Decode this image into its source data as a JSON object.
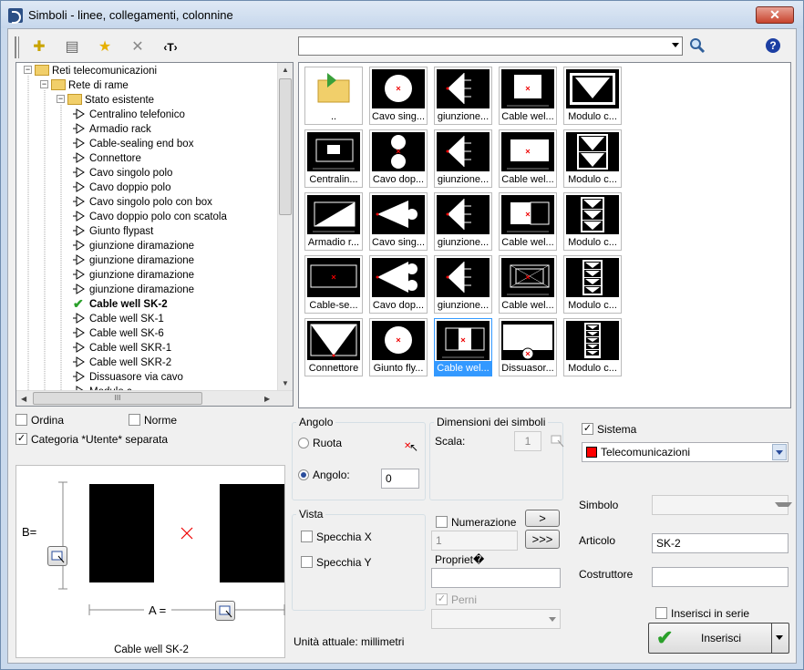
{
  "window": {
    "title": "Simboli - linee, collegamenti, colonnine",
    "close_glyph": "✕"
  },
  "toolbar": {
    "buttons": [
      {
        "name": "add-icon",
        "glyph": "✚"
      },
      {
        "name": "properties-icon",
        "glyph": "▤"
      },
      {
        "name": "favorite-star-icon",
        "glyph": "★"
      },
      {
        "name": "delete-icon",
        "glyph": "✕"
      },
      {
        "name": "text-tag-icon",
        "glyph": "‹T›"
      }
    ],
    "search_value": "",
    "search_icon": "magnifier-icon",
    "help_glyph": "?"
  },
  "tree": {
    "nodes": [
      {
        "label": "Reti telecomunicazioni",
        "type": "folder",
        "level": 0
      },
      {
        "label": "Rete di rame",
        "type": "folder",
        "level": 1
      },
      {
        "label": "Stato esistente",
        "type": "folder",
        "level": 2
      },
      {
        "label": "Centralino telefonico",
        "type": "symbol",
        "level": 3
      },
      {
        "label": "Armadio rack",
        "type": "symbol",
        "level": 3
      },
      {
        "label": "Cable-sealing end box",
        "type": "symbol",
        "level": 3
      },
      {
        "label": "Connettore",
        "type": "symbol",
        "level": 3
      },
      {
        "label": "Cavo singolo polo",
        "type": "symbol",
        "level": 3
      },
      {
        "label": "Cavo doppio polo",
        "type": "symbol",
        "level": 3
      },
      {
        "label": "Cavo singolo polo con box",
        "type": "symbol",
        "level": 3
      },
      {
        "label": "Cavo doppio polo con scatola",
        "type": "symbol",
        "level": 3
      },
      {
        "label": "Giunto flypast",
        "type": "symbol",
        "level": 3
      },
      {
        "label": "giunzione diramazione",
        "type": "symbol",
        "level": 3
      },
      {
        "label": "giunzione diramazione",
        "type": "symbol",
        "level": 3
      },
      {
        "label": "giunzione diramazione",
        "type": "symbol",
        "level": 3
      },
      {
        "label": "giunzione diramazione",
        "type": "symbol",
        "level": 3
      },
      {
        "label": "Cable well SK-2",
        "type": "selected",
        "level": 3
      },
      {
        "label": "Cable well SK-1",
        "type": "symbol",
        "level": 3
      },
      {
        "label": "Cable well SK-6",
        "type": "symbol",
        "level": 3
      },
      {
        "label": "Cable well SKR-1",
        "type": "symbol",
        "level": 3
      },
      {
        "label": "Cable well SKR-2",
        "type": "symbol",
        "level": 3
      },
      {
        "label": "Dissuasore via cavo",
        "type": "symbol",
        "level": 3
      },
      {
        "label": "Modulo c...",
        "type": "symbol",
        "level": 3
      }
    ],
    "hscroll_grip": "III"
  },
  "grid": {
    "cells": [
      {
        "label": "..",
        "kind": "folder-up"
      },
      {
        "label": "Cavo sing...",
        "kind": "circle"
      },
      {
        "label": "giunzione...",
        "kind": "tri-left"
      },
      {
        "label": "Cable wel...",
        "kind": "cable-small"
      },
      {
        "label": "Modulo c...",
        "kind": "modulo1"
      },
      {
        "label": "Centralin...",
        "kind": "centralino"
      },
      {
        "label": "Cavo dop...",
        "kind": "double-circle"
      },
      {
        "label": "giunzione...",
        "kind": "tri-left"
      },
      {
        "label": "Cable wel...",
        "kind": "cable-mid"
      },
      {
        "label": "Modulo c...",
        "kind": "modulo2"
      },
      {
        "label": "Armadio r...",
        "kind": "armadio"
      },
      {
        "label": "Cavo sing...",
        "kind": "tri-circle"
      },
      {
        "label": "giunzione...",
        "kind": "tri-left"
      },
      {
        "label": "Cable wel...",
        "kind": "cable-half"
      },
      {
        "label": "Modulo c...",
        "kind": "modulo3"
      },
      {
        "label": "Cable-se...",
        "kind": "cable-sealing"
      },
      {
        "label": "Cavo dop...",
        "kind": "tri-double"
      },
      {
        "label": "giunzione...",
        "kind": "tri-left"
      },
      {
        "label": "Cable wel...",
        "kind": "cable-nested"
      },
      {
        "label": "Modulo c...",
        "kind": "modulo4"
      },
      {
        "label": "Connettore",
        "kind": "connettore"
      },
      {
        "label": "Giunto fly...",
        "kind": "circle"
      },
      {
        "label": "Cable wel...",
        "kind": "cable-sel",
        "selected": true
      },
      {
        "label": "Dissuasor...",
        "kind": "dissuasore"
      },
      {
        "label": "Modulo c...",
        "kind": "modulo5"
      }
    ]
  },
  "options": {
    "ordina": {
      "label": "Ordina",
      "checked": false
    },
    "norme": {
      "label": "Norme",
      "checked": false
    },
    "categoria": {
      "label": "Categoria *Utente* separata",
      "checked": true
    }
  },
  "preview": {
    "b_label": "B=",
    "a_label": "A =",
    "caption": "Cable well SK-2"
  },
  "angolo": {
    "title": "Angolo",
    "ruota": "Ruota",
    "angolo_label": "Angolo:",
    "angolo_value": "0",
    "selected": "angolo"
  },
  "dimensioni": {
    "title": "Dimensioni dei simboli",
    "scala_label": "Scala:",
    "scala_value": "1"
  },
  "vista": {
    "title": "Vista",
    "specchia_x": {
      "label": "Specchia X",
      "checked": false
    },
    "specchia_y": {
      "label": "Specchia Y",
      "checked": false
    }
  },
  "numerazione": {
    "label": "Numerazione",
    "checked": false,
    "value": "1",
    "btn_next": ">",
    "btn_all": ">>>"
  },
  "proprieta": {
    "label": "Propriet�",
    "value": ""
  },
  "perni": {
    "label": "Perni",
    "checked": true
  },
  "unita": "Unità attuale: millimetri",
  "sistema": {
    "label": "Sistema",
    "checked": true,
    "value": "Telecomunicazioni",
    "color": "#ff0000"
  },
  "fields": {
    "simbolo_label": "Simbolo",
    "simbolo_value": "",
    "articolo_label": "Articolo",
    "articolo_value": "SK-2",
    "costruttore_label": "Costruttore",
    "costruttore_value": ""
  },
  "inserisci_serie": {
    "label": "Inserisci in serie",
    "checked": false
  },
  "inserisci_button": "Inserisci",
  "colors": {
    "selection": "#3399ff",
    "accent_red": "#ff0000",
    "check_green": "#2aa02a"
  }
}
